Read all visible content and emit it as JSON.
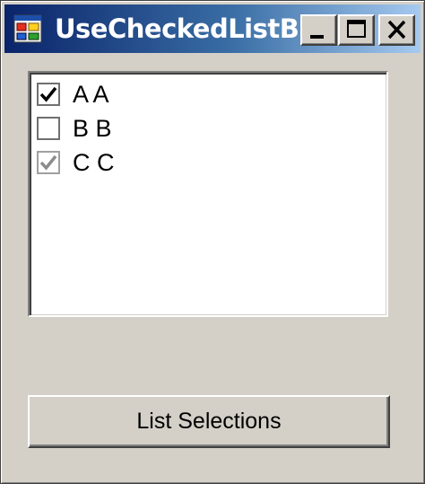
{
  "window": {
    "title": "UseCheckedListB...",
    "icon": "app-form-icon",
    "controls": {
      "minimize_icon": "minimize-icon",
      "maximize_icon": "maximize-icon",
      "close_icon": "close-icon"
    }
  },
  "checked_list": {
    "items": [
      {
        "label": "A A",
        "state": "checked"
      },
      {
        "label": "B B",
        "state": "unchecked"
      },
      {
        "label": "C C",
        "state": "indeterminate"
      }
    ]
  },
  "actions": {
    "list_selections_label": "List Selections"
  },
  "colors": {
    "titlebar_start": "#0a246a",
    "titlebar_end": "#a6caf0",
    "face": "#d4d0c8",
    "check_enabled": "#000000",
    "check_disabled": "#8c8c8c"
  }
}
